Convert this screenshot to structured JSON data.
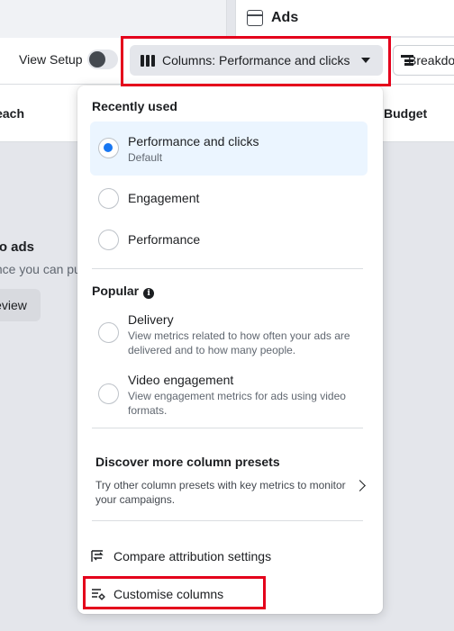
{
  "header": {
    "ads_tab_title": "Ads"
  },
  "toolbar": {
    "view_setup_label": "View Setup",
    "view_setup_on": false,
    "columns_button_label": "Columns: Performance and clicks",
    "breakdown_button_label": "Breakdown"
  },
  "table": {
    "col_reach": "Reach",
    "col_budget": "Budget"
  },
  "empty_state": {
    "title": "No ads",
    "description": "Once you can publish",
    "review_button": "Review"
  },
  "dropdown": {
    "recently_used_title": "Recently used",
    "recent_options": [
      {
        "label": "Performance and clicks",
        "sublabel": "Default",
        "selected": true
      },
      {
        "label": "Engagement",
        "selected": false
      },
      {
        "label": "Performance",
        "selected": false
      }
    ],
    "popular_title": "Popular",
    "popular_options": [
      {
        "label": "Delivery",
        "description": "View metrics related to how often your ads are delivered and to how many people."
      },
      {
        "label": "Video engagement",
        "description": "View engagement metrics for ads using video formats."
      }
    ],
    "discover": {
      "title": "Discover more column presets",
      "description": "Try other column presets with key metrics to monitor your campaigns."
    },
    "compare_attribution_label": "Compare attribution settings",
    "customise_columns_label": "Customise columns"
  },
  "colors": {
    "accent_blue": "#1877f2",
    "selected_bg": "#ebf5ff",
    "highlight_red": "#e4001b"
  },
  "icons": {
    "columns": "columns-icon",
    "breakdown": "breakdown-icon",
    "panel": "panel-icon",
    "info": "info-icon",
    "chevron": "chevron-right-icon",
    "compare": "compare-attribution-icon",
    "customise": "customise-columns-icon"
  }
}
